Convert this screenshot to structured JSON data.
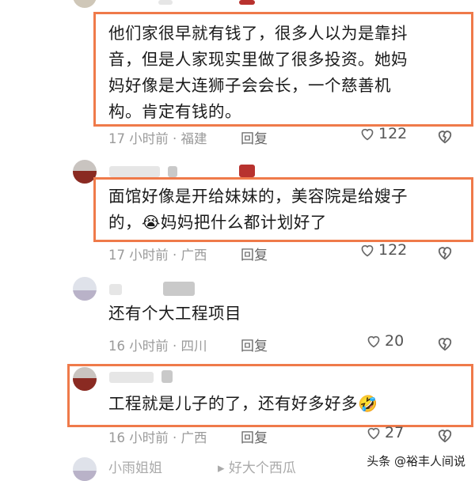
{
  "comments": [
    {
      "text": "他们家很早就有钱了，很多人以为是靠抖\n音，但是人家现实里做了很多投资。她妈\n妈好像是大连狮子会会长，一个慈善机\n构。肯定有钱的。",
      "time_location": "17 小时前 · 福建",
      "reply_label": "回复",
      "likes": "122"
    },
    {
      "text_part1": "面馆好像是开给妹妹的，美容院是给嫂子\n的，",
      "emoji": "😭",
      "text_part2": "妈妈把什么都计划好了",
      "time_location": "17 小时前 · 广西",
      "reply_label": "回复",
      "likes": "122"
    },
    {
      "text": "还有个大工程项目",
      "time_location": "16 小时前 · 四川",
      "reply_label": "回复",
      "likes": "20"
    },
    {
      "text": "工程就是儿子的了，还有好多好多",
      "emoji": "🤣",
      "time_location": "16 小时前 · 广西",
      "reply_label": "回复",
      "likes": "27"
    }
  ],
  "peek": {
    "name": "小雨姐姐",
    "extra": "▸ 好大个西瓜"
  },
  "watermark": "头条 @裕丰人间说",
  "accent_color": "#ef7a4a"
}
